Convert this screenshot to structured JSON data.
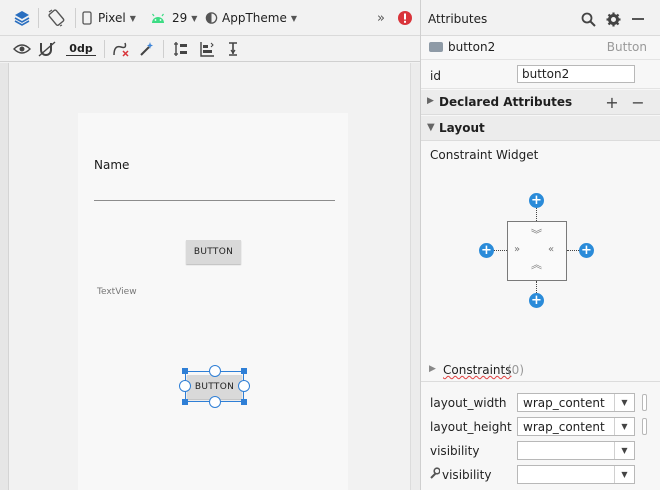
{
  "toolbar": {
    "device": "Pixel",
    "api": "29",
    "theme": "AppTheme",
    "margin": "0dp",
    "overflow": "»"
  },
  "preview": {
    "name_label": "Name",
    "button1_label": "BUTTON",
    "textview_label": "TextView",
    "button2_label": "BUTTON"
  },
  "attributes": {
    "title": "Attributes",
    "component_name": "button2",
    "component_type": "Button",
    "id_label": "id",
    "id_value": "button2",
    "declared_title": "Declared Attributes",
    "layout_title": "Layout",
    "widget_label": "Constraint Widget",
    "constraints_label": "Constraints",
    "constraints_count": "(0)",
    "rows": [
      {
        "label": "layout_width",
        "value": "wrap_content"
      },
      {
        "label": "layout_height",
        "value": "wrap_content"
      },
      {
        "label": "visibility",
        "value": ""
      },
      {
        "label": "visibility",
        "value": ""
      }
    ]
  },
  "colors": {
    "accent": "#2a8bd9",
    "selection": "#2f7fd6",
    "error": "#d9343a",
    "android_green": "#3ddc84"
  }
}
